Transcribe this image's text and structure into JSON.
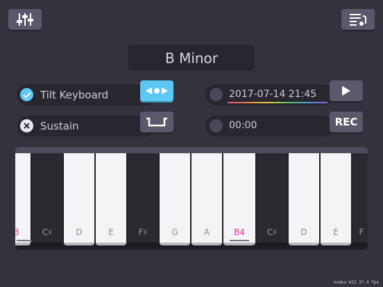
{
  "topbar": {
    "mixer_icon": "sliders-icon",
    "playlist_icon": "playlist-music-icon"
  },
  "key_display": {
    "label": "B Minor"
  },
  "tilt": {
    "label": "Tilt Keyboard",
    "checked": true,
    "icon": "check-icon",
    "button_icon": "arrows-left-dot-right-icon"
  },
  "sustain": {
    "label": "Sustain",
    "checked": false,
    "icon": "x-icon",
    "button_icon": "sustain-pedal-icon"
  },
  "recording": {
    "title": "2017-07-14 21:45",
    "play_icon": "play-icon"
  },
  "recorder": {
    "time": "00:00",
    "rec_label": "REC"
  },
  "keyboard": {
    "white_keys": [
      {
        "label": "3",
        "highlight": true
      },
      {
        "label": "D",
        "highlight": false
      },
      {
        "label": "E",
        "highlight": false
      },
      {
        "label": "G",
        "highlight": false
      },
      {
        "label": "A",
        "highlight": false
      },
      {
        "label": "B4",
        "highlight": true
      },
      {
        "label": "D",
        "highlight": false
      },
      {
        "label": "E",
        "highlight": false
      },
      {
        "label": "F",
        "highlight": false
      }
    ],
    "black_keys": [
      {
        "label": "C♯"
      },
      {
        "label": "F♯"
      },
      {
        "label": "C♯"
      }
    ]
  },
  "footer": {
    "stats": "nodes:423  37.4 fps"
  },
  "colors": {
    "accent": "#5ec8f5",
    "highlight": "#d63a8d",
    "background": "#34323d"
  }
}
